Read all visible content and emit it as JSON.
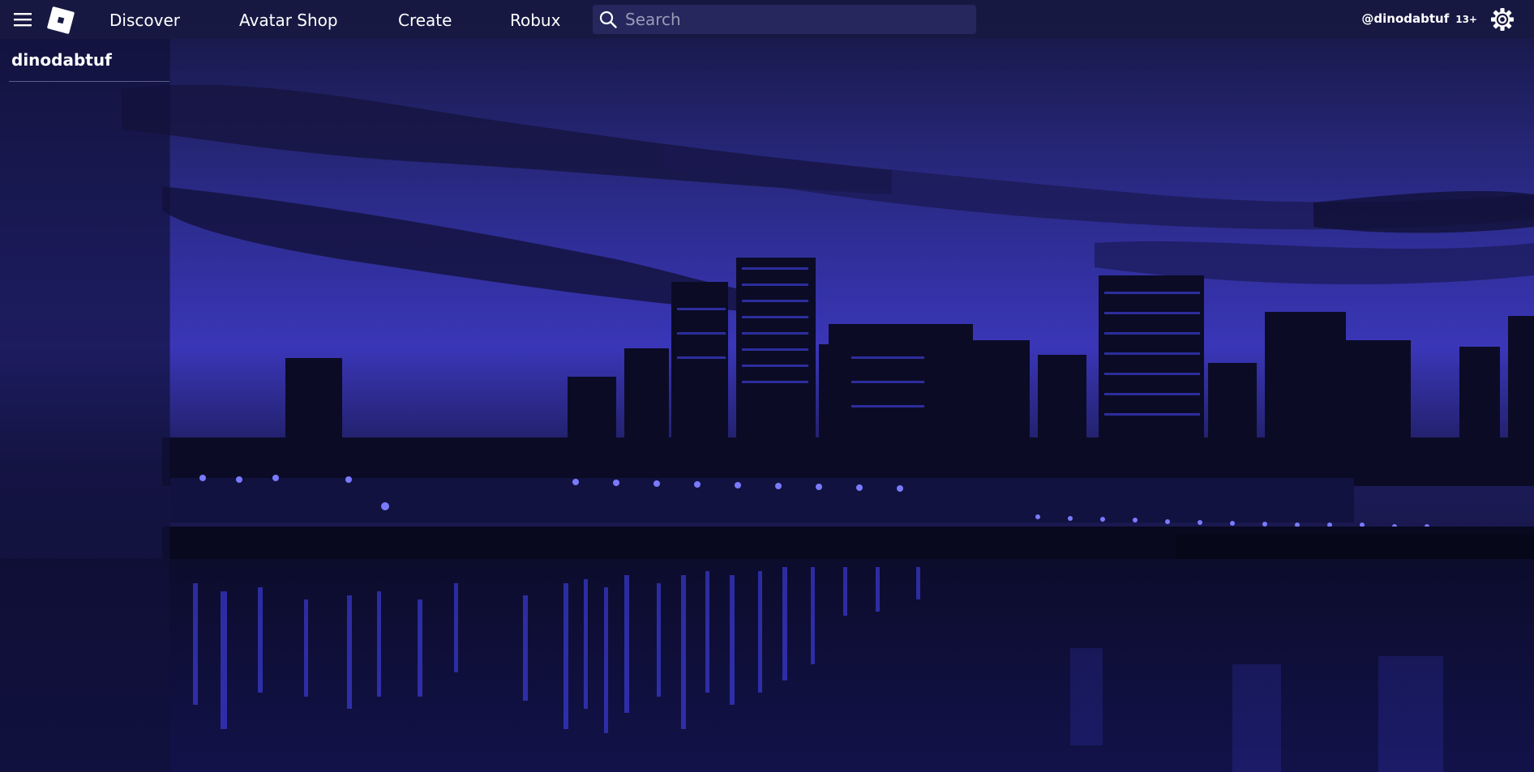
{
  "nav": {
    "menu_icon": "hamburger-menu-icon",
    "logo_icon": "roblox-logo-icon",
    "links": {
      "discover": "Discover",
      "avatar_shop": "Avatar Shop",
      "create": "Create",
      "robux": "Robux"
    },
    "search": {
      "placeholder": "Search",
      "value": "",
      "icon": "search-icon"
    },
    "user": {
      "handle": "@dinodabtuf",
      "age_badge": "13+"
    },
    "settings_icon": "gear-icon"
  },
  "sidebar": {
    "username": "dinodabtuf"
  },
  "colors": {
    "topbar": "#181942",
    "accent_blue": "#3b3bff",
    "text": "#ffffff"
  }
}
